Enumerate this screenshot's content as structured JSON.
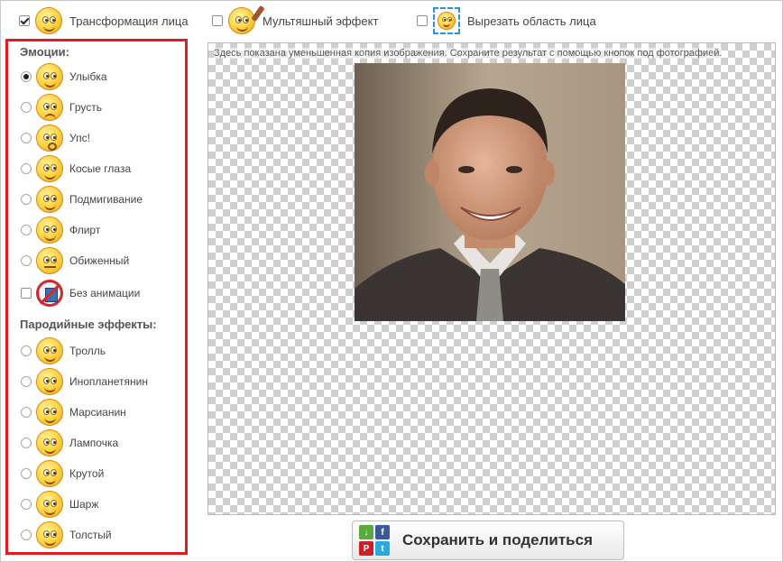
{
  "top_options": [
    {
      "label": "Трансформация лица",
      "checked": true,
      "icon": "face-transform-icon"
    },
    {
      "label": "Мультяшный эффект",
      "checked": false,
      "icon": "cartoon-effect-icon"
    },
    {
      "label": "Вырезать область лица",
      "checked": false,
      "icon": "crop-face-icon"
    }
  ],
  "emotions": {
    "title": "Эмоции:",
    "items": [
      {
        "label": "Улыбка",
        "selected": true,
        "icon": "smile-icon"
      },
      {
        "label": "Грусть",
        "selected": false,
        "icon": "sad-icon"
      },
      {
        "label": "Упс!",
        "selected": false,
        "icon": "oops-icon"
      },
      {
        "label": "Косые глаза",
        "selected": false,
        "icon": "cross-eyed-icon"
      },
      {
        "label": "Подмигивание",
        "selected": false,
        "icon": "wink-icon"
      },
      {
        "label": "Флирт",
        "selected": false,
        "icon": "flirt-icon"
      },
      {
        "label": "Обиженный",
        "selected": false,
        "icon": "offended-icon"
      }
    ],
    "no_animation": {
      "label": "Без анимации",
      "checked": false,
      "icon": "no-animation-icon"
    }
  },
  "parody": {
    "title": "Пародийные эффекты:",
    "items": [
      {
        "label": "Тролль",
        "selected": false,
        "icon": "troll-icon"
      },
      {
        "label": "Инопланетянин",
        "selected": false,
        "icon": "alien-icon"
      },
      {
        "label": "Марсианин",
        "selected": false,
        "icon": "martian-icon"
      },
      {
        "label": "Лампочка",
        "selected": false,
        "icon": "lightbulb-icon"
      },
      {
        "label": "Крутой",
        "selected": false,
        "icon": "cool-icon"
      },
      {
        "label": "Шарж",
        "selected": false,
        "icon": "caricature-icon"
      },
      {
        "label": "Толстый",
        "selected": false,
        "icon": "fat-icon"
      }
    ]
  },
  "preview": {
    "note": "Здесь показана уменьшенная копия изображения. Сохраните результат с помощью кнопок под фотографией."
  },
  "save_button": {
    "label": "Сохранить и поделиться"
  },
  "colors": {
    "highlight_border": "#e01b22",
    "checker": "#cfcfcf"
  }
}
